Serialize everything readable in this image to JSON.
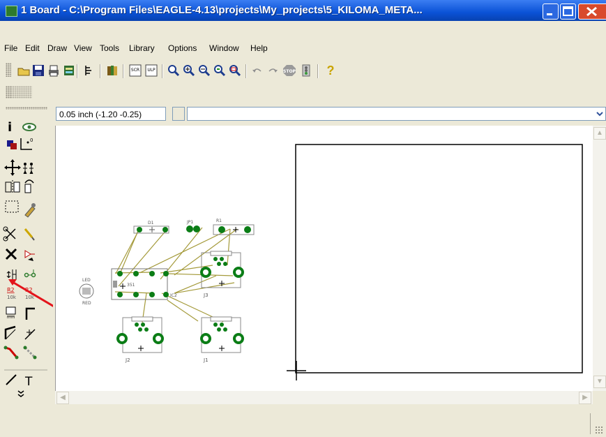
{
  "window": {
    "title": "1 Board - C:\\Program Files\\EAGLE-4.13\\projects\\My_projects\\5_KILOMA_META...",
    "minimize_icon": "minimize-icon",
    "maximize_icon": "maximize-icon",
    "close_icon": "close-icon"
  },
  "menu": {
    "items": [
      "File",
      "Edit",
      "Draw",
      "View",
      "Tools",
      "Library",
      "Options",
      "Window",
      "Help"
    ]
  },
  "toolbar": {
    "icons": [
      "open-icon",
      "save-icon",
      "print-icon",
      "cam-icon",
      "schematic-icon",
      "library-icon",
      "script-icon",
      "ulp-icon",
      "zoom-fit-icon",
      "zoom-in-icon",
      "zoom-out-icon",
      "zoom-redraw-icon",
      "zoom-select-icon",
      "undo-icon",
      "redo-icon",
      "stop-icon",
      "go-icon",
      "help-icon"
    ],
    "script_label": "SCR",
    "ulp_label": "ULP",
    "stop_label": "STOP",
    "help_label": "?"
  },
  "command_bar": {
    "coordinate": "0.05 inch (-1.20 -0.25)",
    "command_value": ""
  },
  "left_tools": [
    "info-icon",
    "show-icon",
    "display-icon",
    "mark-icon",
    "move-icon",
    "copy-icon",
    "mirror-icon",
    "rotate-icon",
    "group-icon",
    "change-icon",
    "cut-icon",
    "paste-icon",
    "delete-icon",
    "add-icon",
    "pinswap-icon",
    "gateswap-icon",
    "replace-icon",
    "name-icon",
    "value-icon",
    "smash-icon",
    "miter-icon",
    "split-icon",
    "route-icon",
    "ripup-icon",
    "wire-icon",
    "text-icon",
    "more-icon"
  ],
  "left_tool_labels": {
    "r2_a": "R2",
    "r2_b": "R2",
    "k10_a": "10k",
    "k10_b": "10k",
    "text": "T",
    "more": "»"
  },
  "board": {
    "parts": {
      "d1": "D1",
      "jp1": "JP1",
      "r1": "R1",
      "led": "LED",
      "red": "RED",
      "ic": "IC2",
      "j1": "J1",
      "j2": "J2",
      "j3": "J3"
    }
  },
  "colors": {
    "pad": "#0b7d16",
    "airwire": "#a49a3a",
    "outline": "#777777",
    "annotation_arrow": "#e3141b",
    "title_bar": "#0a52d6"
  }
}
